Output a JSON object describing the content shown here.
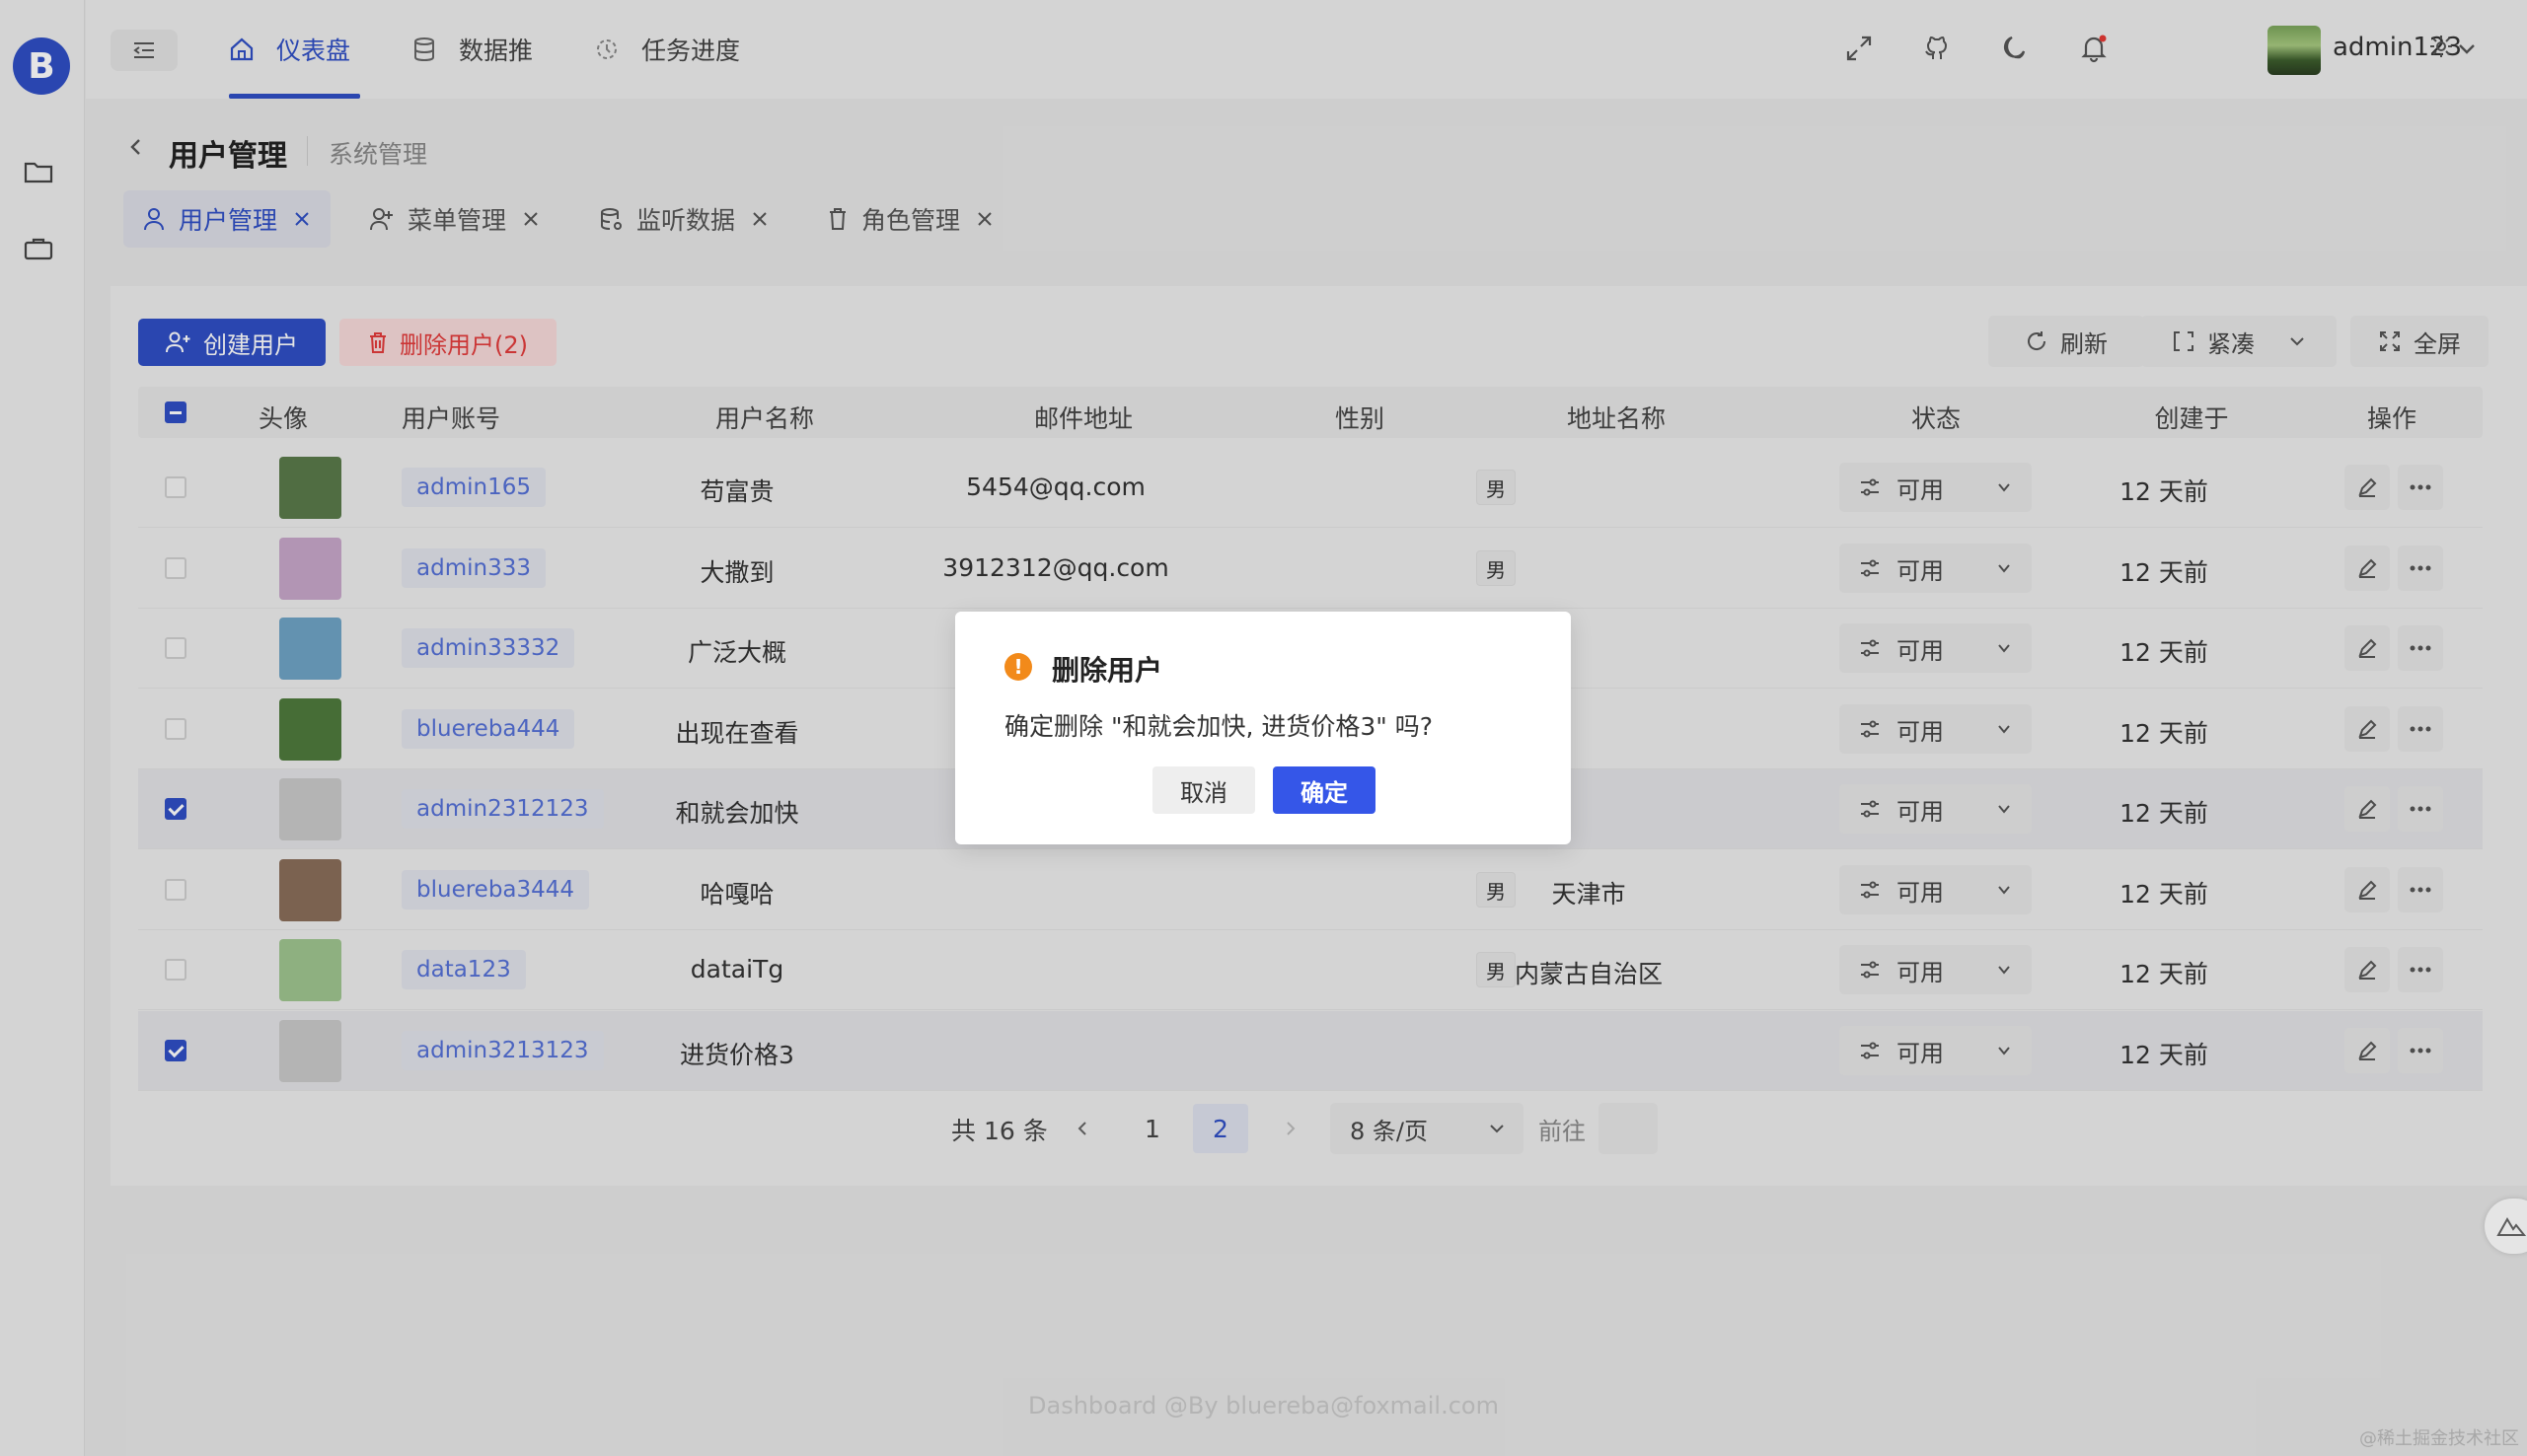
{
  "app": {
    "logo_letter": "B"
  },
  "header": {
    "nav": [
      {
        "label": "仪表盘",
        "icon": "home-icon",
        "active": true
      },
      {
        "label": "数据推",
        "icon": "database-icon",
        "active": false
      },
      {
        "label": "任务进度",
        "icon": "progress-icon",
        "active": false
      }
    ],
    "username": "admin123"
  },
  "page": {
    "title": "用户管理",
    "subtitle": "系统管理"
  },
  "tabs": [
    {
      "label": "用户管理",
      "icon": "user-icon",
      "active": true
    },
    {
      "label": "菜单管理",
      "icon": "user-add-icon",
      "active": false
    },
    {
      "label": "监听数据",
      "icon": "database-icon",
      "active": false
    },
    {
      "label": "角色管理",
      "icon": "trash-icon",
      "active": false
    }
  ],
  "toolbar": {
    "create_label": "创建用户",
    "delete_label": "删除用户(2)",
    "refresh_label": "刷新",
    "density_label": "紧凑",
    "fullscreen_label": "全屏"
  },
  "table": {
    "columns": [
      "头像",
      "用户账号",
      "用户名称",
      "邮件地址",
      "性别",
      "地址名称",
      "状态",
      "创建于",
      "操作"
    ],
    "rows": [
      {
        "account": "admin165",
        "name": "苟富贵",
        "email": "5454@qq.com",
        "gender": "男",
        "address": "",
        "status": "可用",
        "created": "12 天前",
        "checked": false,
        "avatar_color": "#5a7a4a"
      },
      {
        "account": "admin333",
        "name": "大撒到",
        "email": "3912312@qq.com",
        "gender": "男",
        "address": "",
        "status": "可用",
        "created": "12 天前",
        "checked": false,
        "avatar_color": "#c7a6c9"
      },
      {
        "account": "admin33332",
        "name": "广泛大概",
        "email": "",
        "gender": "",
        "address": "",
        "status": "可用",
        "created": "12 天前",
        "checked": false,
        "avatar_color": "#6fa3c4"
      },
      {
        "account": "bluereba444",
        "name": "出现在查看",
        "email": "",
        "gender": "",
        "address": "",
        "status": "可用",
        "created": "12 天前",
        "checked": false,
        "avatar_color": "#4f7a3d"
      },
      {
        "account": "admin2312123",
        "name": "和就会加快",
        "email": "",
        "gender": "",
        "address": "",
        "status": "可用",
        "created": "12 天前",
        "checked": true,
        "avatar_color": "#c9c9c9"
      },
      {
        "account": "bluereba3444",
        "name": "哈嘎哈",
        "email": "",
        "gender": "男",
        "address": "天津市",
        "status": "可用",
        "created": "12 天前",
        "checked": false,
        "avatar_color": "#8a6e5a"
      },
      {
        "account": "data123",
        "name": "dataiTg",
        "email": "",
        "gender": "男",
        "address": "内蒙古自治区",
        "status": "可用",
        "created": "12 天前",
        "checked": false,
        "avatar_color": "#9fc48f"
      },
      {
        "account": "admin3213123",
        "name": "进货价格3",
        "email": "",
        "gender": "",
        "address": "",
        "status": "可用",
        "created": "12 天前",
        "checked": true,
        "avatar_color": "#c9c9c9"
      }
    ]
  },
  "pagination": {
    "total": "共 16 条",
    "pages": [
      "1",
      "2"
    ],
    "current": "2",
    "page_size": "8 条/页",
    "goto": "前往"
  },
  "footer": "Dashboard @By bluereba@foxmail.com",
  "watermark": "@稀土掘金技术社区",
  "dialog": {
    "title": "删除用户",
    "message": "确定删除 \"和就会加快, 进货价格3\" 吗?",
    "cancel": "取消",
    "ok": "确定"
  }
}
